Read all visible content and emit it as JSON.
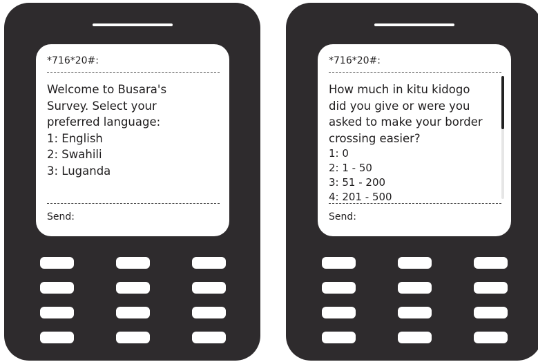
{
  "phones": [
    {
      "ussd_code": "*716*20#:",
      "message_lines": [
        "Welcome to Busara's",
        "Survey. Select your",
        "preferred language:"
      ],
      "options": [
        "1: English",
        "2: Swahili",
        "3: Luganda"
      ],
      "send_label": "Send:"
    },
    {
      "ussd_code": "*716*20#:",
      "message_lines": [
        "How much in kitu kidogo",
        "did you give or were you",
        "asked to make your border",
        "crossing easier?"
      ],
      "options": [
        "1: 0",
        "2: 1 - 50",
        "3: 51 - 200",
        "4: 201 - 500"
      ],
      "send_label": "Send:",
      "scroll_fraction_visible": 0.43
    }
  ],
  "colors": {
    "phone_body": "#2e2b2d",
    "screen": "#ffffff",
    "key": "#ffffff"
  }
}
